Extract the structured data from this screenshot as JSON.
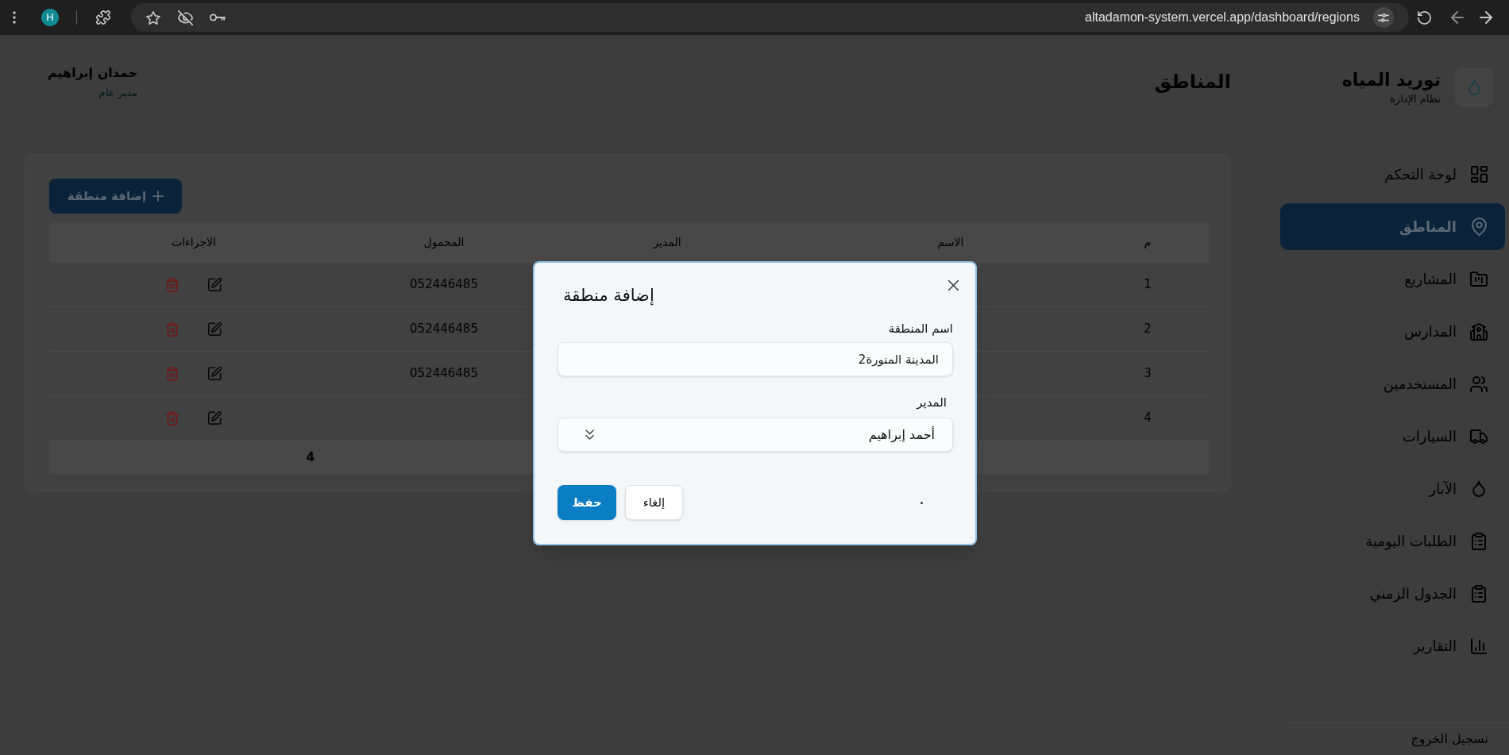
{
  "browser": {
    "profile_initial": "H",
    "url": "altadamon-system.vercel.app/dashboard/regions"
  },
  "sidebar": {
    "app_title": "توريد المياه",
    "app_subtitle": "نظام الإدارة",
    "items": [
      {
        "label": "لوحة التحكم",
        "selected": false
      },
      {
        "label": "المناطق",
        "selected": true
      },
      {
        "label": "المشاريع",
        "selected": false
      },
      {
        "label": "المدارس",
        "selected": false
      },
      {
        "label": "المستخدمين",
        "selected": false
      },
      {
        "label": "السيارات",
        "selected": false
      },
      {
        "label": "الآبار",
        "selected": false
      },
      {
        "label": "الطلبات اليومية",
        "selected": false
      },
      {
        "label": "الجدول الزمني",
        "selected": false
      },
      {
        "label": "التقارير",
        "selected": false
      }
    ],
    "logout": "تسجيل الخروج"
  },
  "header": {
    "title": "المناطق",
    "user_name": "حمدان إبراهيم",
    "user_role": "مدير عام"
  },
  "regions_card": {
    "add_button": "إضافة منطقة",
    "table": {
      "columns": [
        "م",
        "الاسم",
        "المدير",
        "المحمول",
        "الاجراءات"
      ],
      "rows": [
        {
          "number": "1",
          "mobile": "052446485"
        },
        {
          "number": "2",
          "mobile": "052446485"
        },
        {
          "number": "3",
          "mobile": "052446485"
        },
        {
          "number": "4"
        }
      ],
      "footer": "4"
    }
  },
  "dialog": {
    "title": "إضافة منطقة",
    "fields": [
      {
        "kind": "text",
        "label": "اسم المنطقة",
        "value": "المدينة المنورة2"
      },
      {
        "kind": "select",
        "label": "المدير",
        "value": "أحمد إبراهيم"
      }
    ],
    "buttons": [
      {
        "kind": "secondary",
        "label": "إلغاء"
      },
      {
        "kind": "primary",
        "label": "حفظ"
      }
    ]
  }
}
